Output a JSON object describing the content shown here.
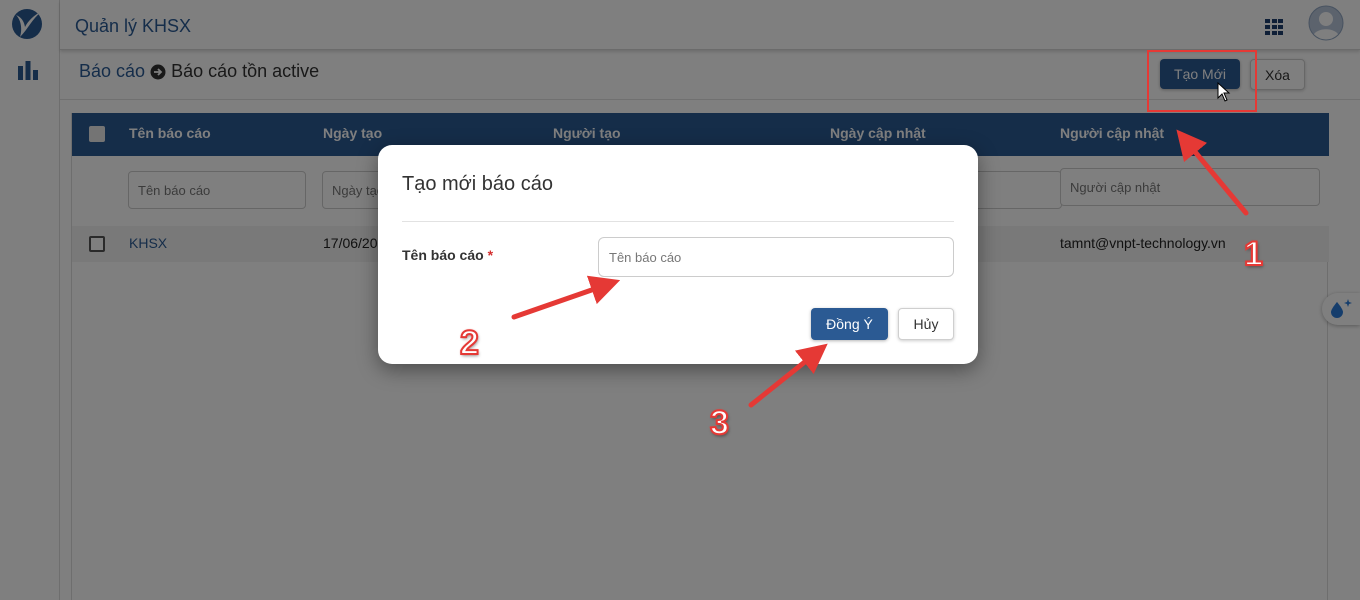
{
  "app": {
    "title": "Quản lý KHSX"
  },
  "breadcrumb": {
    "parent": "Báo cáo",
    "current": "Báo cáo tồn active"
  },
  "toolbar": {
    "new_label": "Tạo Mới",
    "delete_label": "Xóa"
  },
  "table": {
    "columns": [
      "Tên báo cáo",
      "Ngày tạo",
      "Người tạo",
      "Ngày cập nhật",
      "Người cập nhật"
    ],
    "filters": {
      "name_placeholder": "Tên báo cáo",
      "created_placeholder": "Ngày tạo",
      "updater_placeholder": "Người cập nhật"
    },
    "rows": [
      {
        "name": "KHSX",
        "created": "17/06/20",
        "updated_by": "tamnt@vnpt-technology.vn"
      }
    ]
  },
  "modal": {
    "title": "Tạo mới báo cáo",
    "field_label": "Tên báo cáo",
    "required_mark": "*",
    "field_placeholder": "Tên báo cáo",
    "ok_label": "Đồng Ý",
    "cancel_label": "Hủy"
  },
  "annotations": {
    "step1": "1",
    "step2": "2",
    "step3": "3"
  },
  "colors": {
    "primary": "#2b5a93",
    "annotation": "#e53935",
    "header_text": "#2a5a94"
  },
  "icons": [
    "logo-icon",
    "bar-chart-icon",
    "apps-grid-icon",
    "user-avatar-icon",
    "arrow-right-circle-icon",
    "assistant-float-icon",
    "mouse-cursor-icon"
  ]
}
